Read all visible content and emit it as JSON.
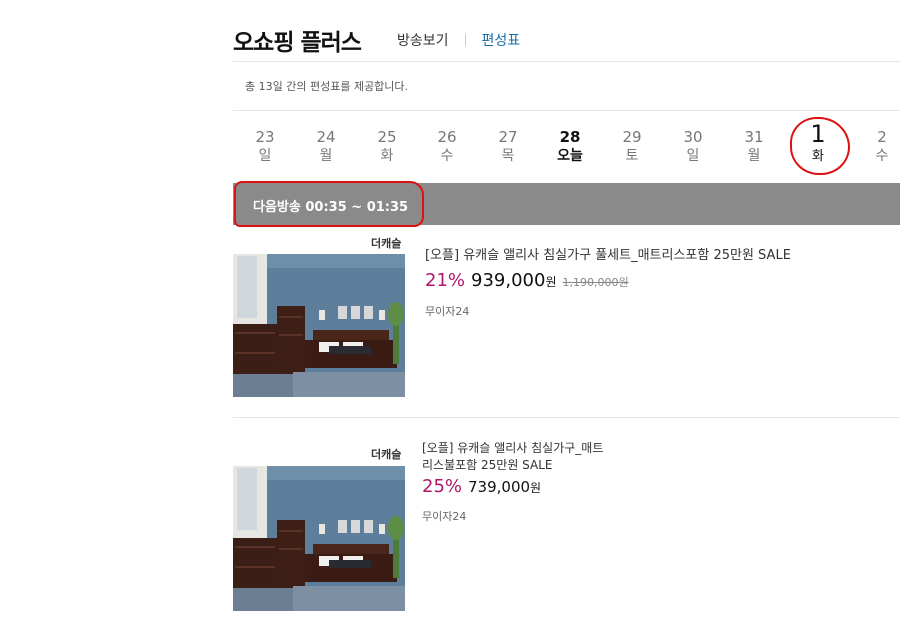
{
  "header": {
    "brand": "오쇼핑 플러스",
    "tabs": [
      {
        "label": "방송보기"
      },
      {
        "label": "편성표"
      }
    ]
  },
  "notice": "총 13일 간의 편성표를 제공합니다.",
  "dates": [
    {
      "num": "23",
      "dow": "일"
    },
    {
      "num": "24",
      "dow": "월"
    },
    {
      "num": "25",
      "dow": "화"
    },
    {
      "num": "26",
      "dow": "수"
    },
    {
      "num": "27",
      "dow": "목"
    },
    {
      "num": "28",
      "dow": "오늘"
    },
    {
      "num": "29",
      "dow": "토"
    },
    {
      "num": "30",
      "dow": "일"
    },
    {
      "num": "31",
      "dow": "월"
    },
    {
      "num": "1",
      "dow": "화"
    },
    {
      "num": "2",
      "dow": "수"
    }
  ],
  "next_broadcast": "다음방송  00:35 ~ 01:35",
  "products": [
    {
      "brand": "더캐슬",
      "title": "[오플] 유캐슬 앨리사 침실가구 풀세트_매트리스포함 25만원 SALE",
      "discount": "21%",
      "price": "939,000",
      "currency": "원",
      "original_price": "1,190,000원",
      "installment": "무이자24"
    },
    {
      "brand": "더캐슬",
      "title_line1": "[오플] 유캐슬 앨리사 침실가구_매트",
      "title_line2": "리스불포함 25만원 SALE",
      "discount": "25%",
      "price": "739,000",
      "currency": "원",
      "installment": "무이자24"
    }
  ],
  "colors": {
    "accent_tab": "#1a6fa8",
    "discount": "#b0166b",
    "annotation": "#dd1111",
    "bar": "#8a8a8a"
  }
}
